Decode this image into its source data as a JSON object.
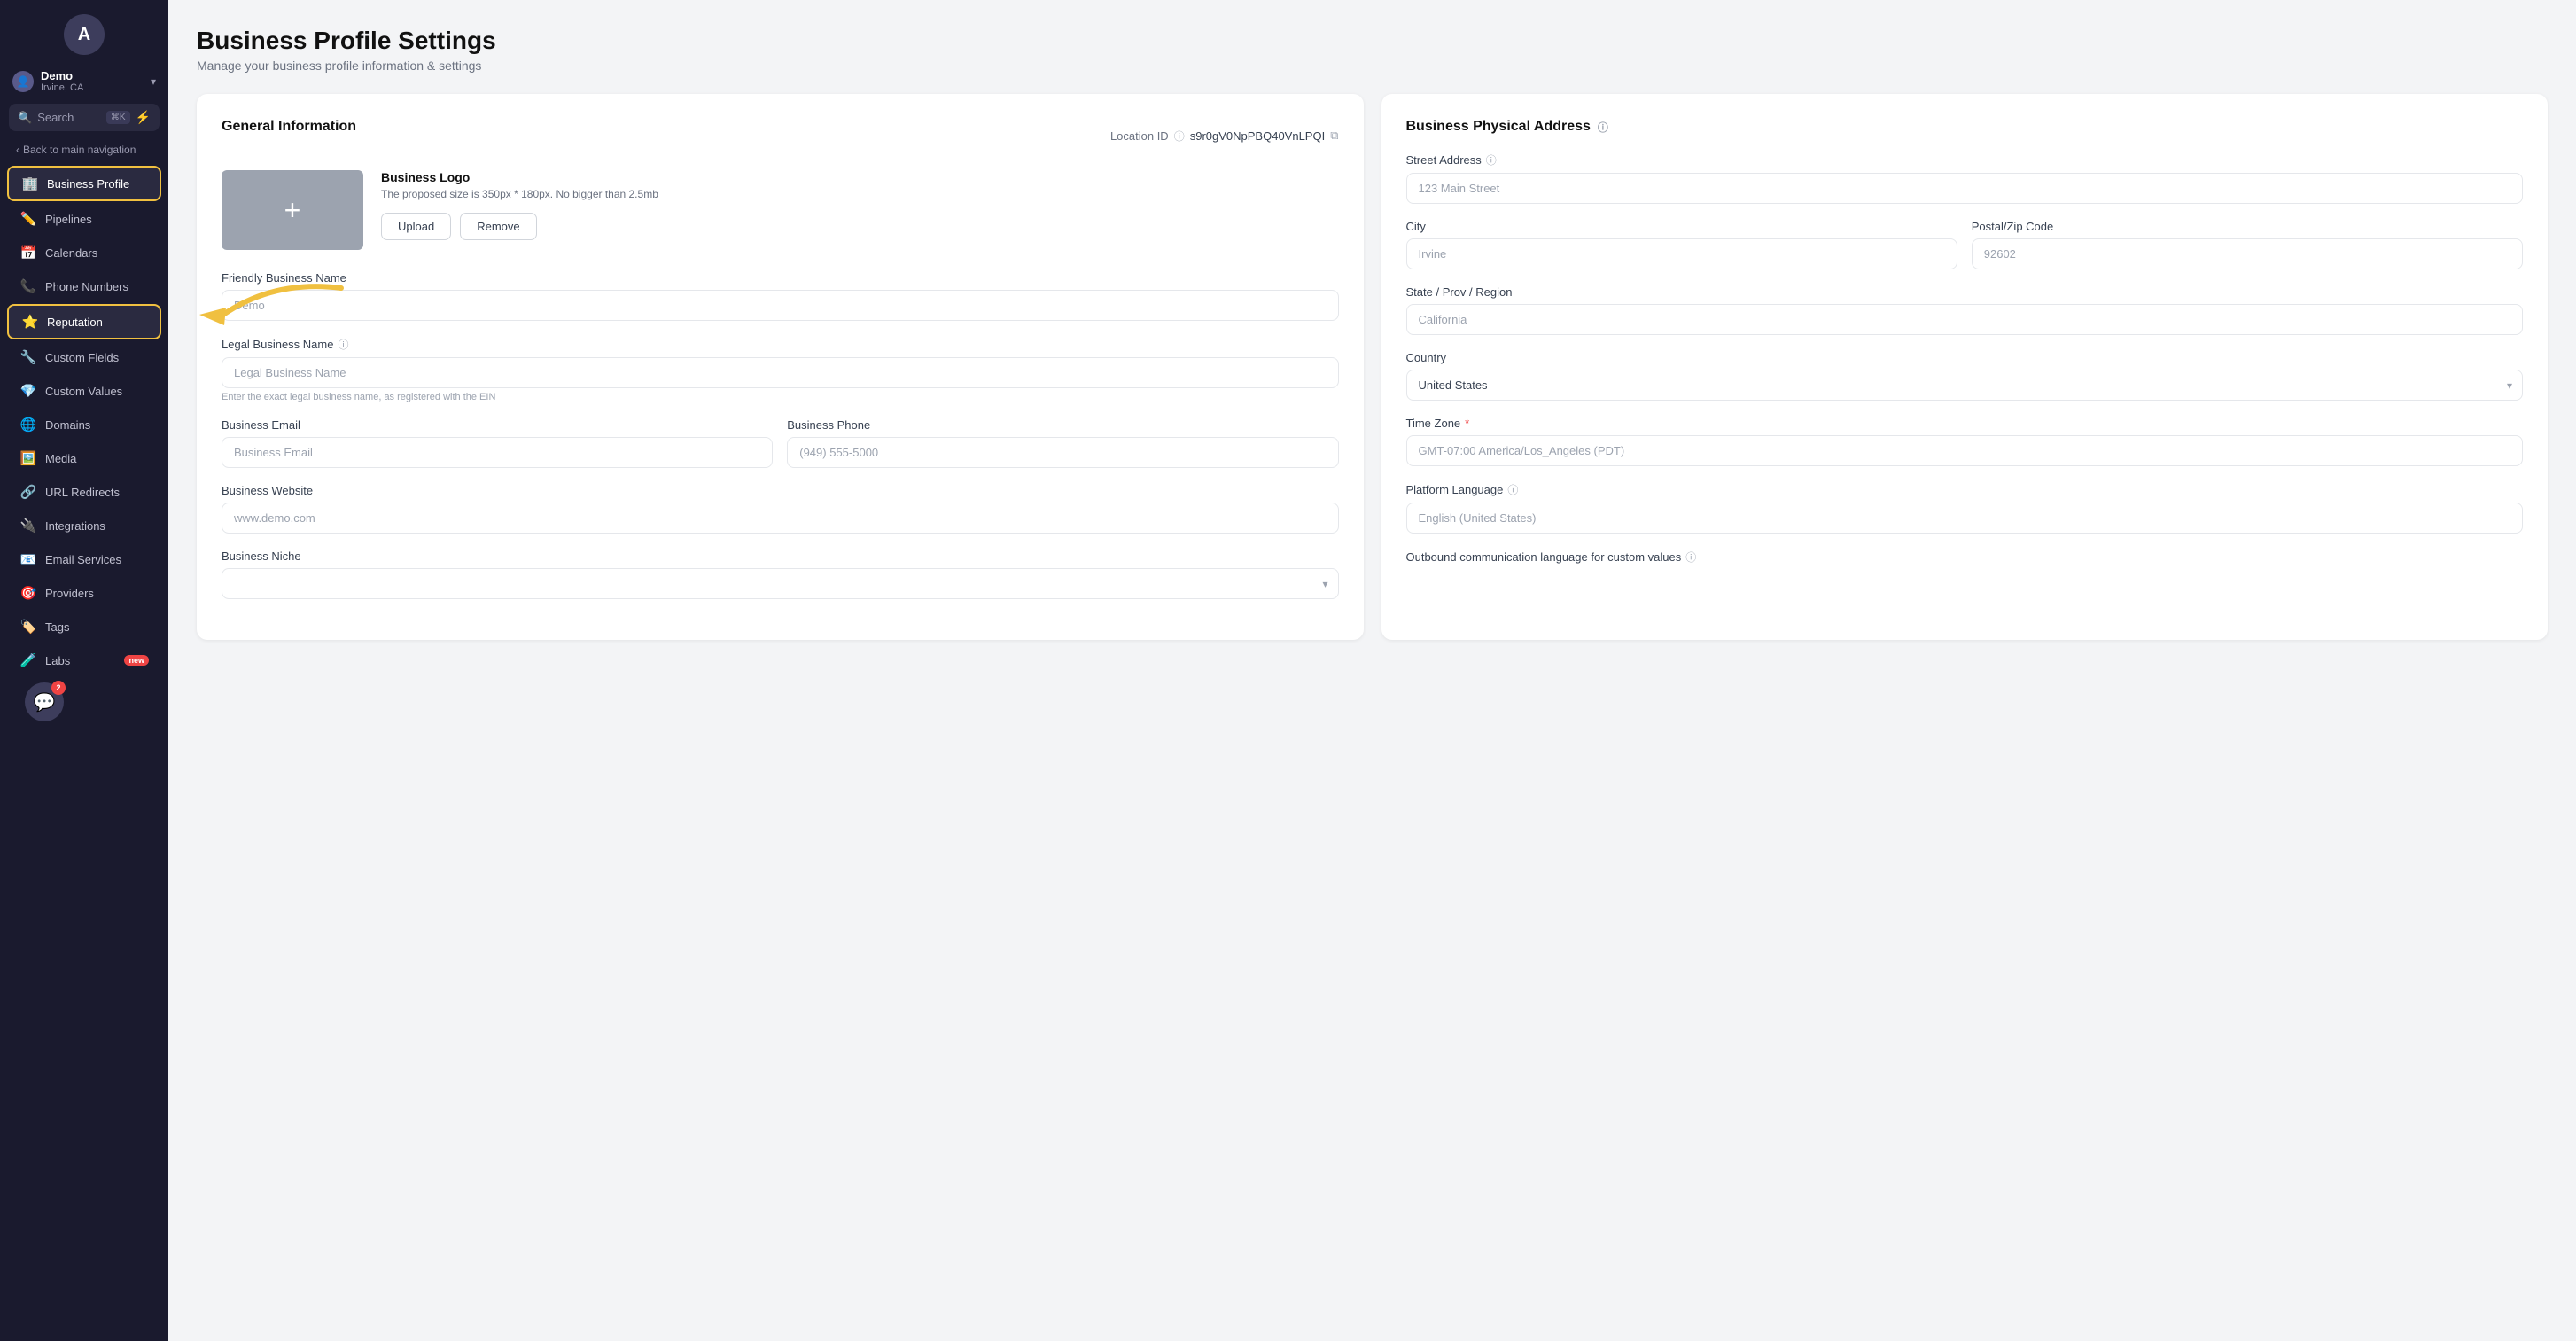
{
  "sidebar": {
    "avatar_letter": "A",
    "account": {
      "name": "Demo",
      "location": "Irvine, CA",
      "arrow": "▾"
    },
    "search": {
      "label": "Search",
      "shortcut": "⌘K"
    },
    "back_label": "Back to main navigation",
    "items": [
      {
        "id": "business-profile",
        "label": "Business Profile",
        "icon": "🏢",
        "active": true
      },
      {
        "id": "pipelines",
        "label": "Pipelines",
        "icon": "✏️",
        "active": false
      },
      {
        "id": "calendars",
        "label": "Calendars",
        "icon": "📅",
        "active": false
      },
      {
        "id": "phone-numbers",
        "label": "Phone Numbers",
        "icon": "📞",
        "active": false
      },
      {
        "id": "reputation",
        "label": "Reputation",
        "icon": "⭐",
        "active": false,
        "highlighted": true
      },
      {
        "id": "custom-fields",
        "label": "Custom Fields",
        "icon": "🔧",
        "active": false
      },
      {
        "id": "custom-values",
        "label": "Custom Values",
        "icon": "💎",
        "active": false
      },
      {
        "id": "domains",
        "label": "Domains",
        "icon": "🌐",
        "active": false
      },
      {
        "id": "media",
        "label": "Media",
        "icon": "🖼️",
        "active": false
      },
      {
        "id": "url-redirects",
        "label": "URL Redirects",
        "icon": "🔗",
        "active": false
      },
      {
        "id": "integrations",
        "label": "Integrations",
        "icon": "🔌",
        "active": false
      },
      {
        "id": "email-services",
        "label": "Email Services",
        "icon": "📧",
        "active": false
      },
      {
        "id": "providers",
        "label": "Providers",
        "icon": "🎯",
        "active": false
      },
      {
        "id": "tags",
        "label": "Tags",
        "icon": "🏷️",
        "active": false
      },
      {
        "id": "labs",
        "label": "Labs",
        "icon": "🧪",
        "active": false,
        "badge": "new"
      }
    ],
    "chat_badge": "2"
  },
  "page": {
    "title": "Business Profile Settings",
    "subtitle": "Manage your business profile information & settings"
  },
  "general": {
    "section_title": "General Information",
    "location_id_label": "Location ID",
    "location_id_value": "s9r0gV0NpPBQ40VnLPQI",
    "logo_label": "Business Logo",
    "logo_desc": "The proposed size is 350px * 180px. No bigger than 2.5mb",
    "upload_btn": "Upload",
    "remove_btn": "Remove",
    "friendly_name_label": "Friendly Business Name",
    "friendly_name_placeholder": "Demo",
    "legal_name_label": "Legal Business Name",
    "legal_name_placeholder": "Legal Business Name",
    "legal_name_hint": "Enter the exact legal business name, as registered with the EIN",
    "email_label": "Business Email",
    "email_placeholder": "Business Email",
    "phone_label": "Business Phone",
    "phone_placeholder": "(949) 555-5000",
    "website_label": "Business Website",
    "website_placeholder": "www.demo.com",
    "niche_label": "Business Niche"
  },
  "address": {
    "section_title": "Business Physical Address",
    "street_label": "Street Address",
    "street_placeholder": "123 Main Street",
    "city_label": "City",
    "city_placeholder": "Irvine",
    "zip_label": "Postal/Zip Code",
    "zip_placeholder": "92602",
    "state_label": "State / Prov / Region",
    "state_placeholder": "California",
    "country_label": "Country",
    "country_placeholder": "United States",
    "timezone_label": "Time Zone",
    "timezone_placeholder": "GMT-07:00 America/Los_Angeles (PDT)",
    "language_label": "Platform Language",
    "language_placeholder": "English (United States)",
    "outbound_label": "Outbound communication language for custom values"
  }
}
